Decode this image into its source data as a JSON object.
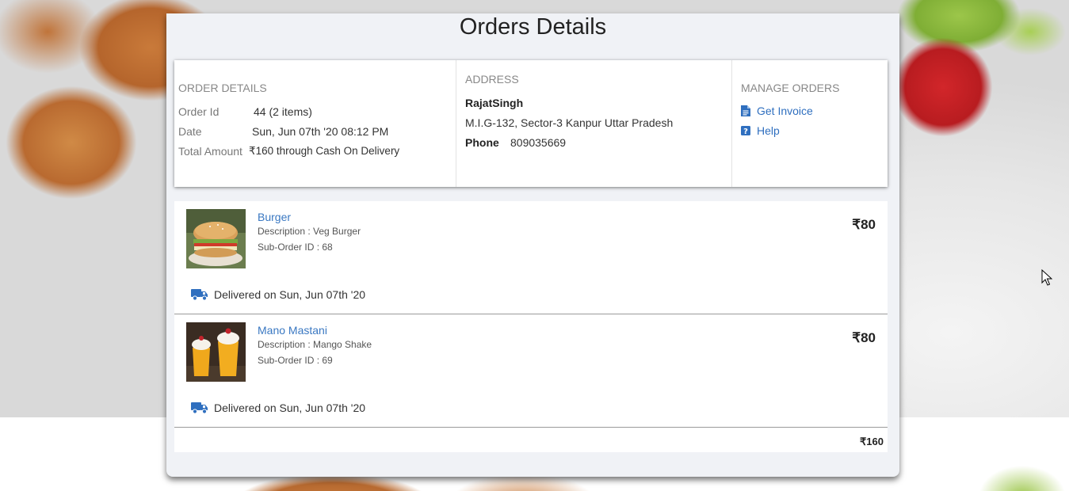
{
  "page": {
    "title": "Orders Details"
  },
  "order_details": {
    "heading": "ORDER DETAILS",
    "order_id_label": "Order Id",
    "order_id_value": "44 (2 items)",
    "date_label": "Date",
    "date_value": "Sun, Jun 07th '20 08:12 PM",
    "total_label": "Total Amount",
    "total_value": "₹160 through Cash On Delivery"
  },
  "address": {
    "heading": "ADDRESS",
    "name": "RajatSingh",
    "line": "M.I.G-132, Sector-3 Kanpur Uttar Pradesh",
    "phone_label": "Phone",
    "phone_value": "809035669"
  },
  "manage": {
    "heading": "MANAGE ORDERS",
    "invoice_label": "Get Invoice",
    "help_label": "Help"
  },
  "items": [
    {
      "name": "Burger",
      "description": "Description : Veg Burger",
      "sub_order": "Sub-Order ID : 68",
      "price": "₹80",
      "delivery": "Delivered on Sun, Jun 07th '20"
    },
    {
      "name": "Mano Mastani",
      "description": "Description : Mango Shake",
      "sub_order": "Sub-Order ID : 69",
      "price": "₹80",
      "delivery": "Delivered on Sun, Jun 07th '20"
    }
  ],
  "total": "₹160",
  "colors": {
    "link": "#3a78c2",
    "icon": "#2f6fbf",
    "panel_bg": "#f0f2f6"
  },
  "icons": {
    "invoice": "file-text-icon",
    "help": "question-square-icon",
    "delivery": "truck-icon"
  }
}
